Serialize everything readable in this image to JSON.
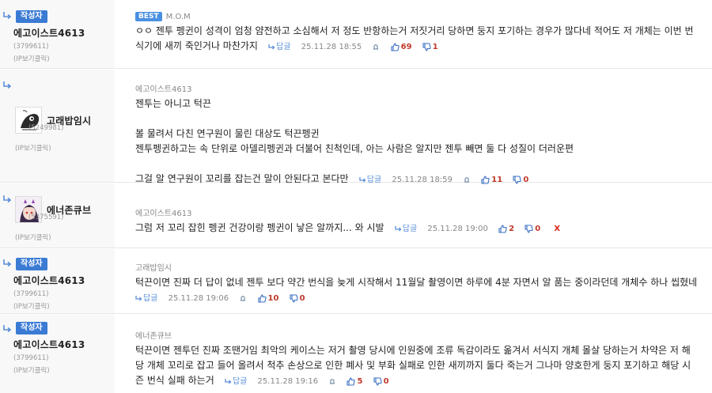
{
  "comments": [
    {
      "writer_badge": "작성자",
      "nick": "에고이스트4613",
      "uid": "(3799611)",
      "ip": "(IP보기클릭)",
      "best": "BEST",
      "ref": "M.O.M",
      "lines": [
        "ㅇㅇ 젠투 펭귄이 성격이 엄청 얌전하고 소심해서 저 정도 반항하는거 저짓거리 당하면 둥지 포기하는 경우가 많다네 적어도 저 개체는 이번 번",
        "식기에 새끼 죽인거나 마찬가지"
      ],
      "reply": "답글",
      "date": "25.11.28 18:55",
      "up": "69",
      "down": "1"
    },
    {
      "nick": "고래밥임시",
      "uid": "(5249981)",
      "ip": "(IP보기클릭)",
      "ref": "에고이스트4613",
      "lines": [
        "젠투는 아니고 턱끈",
        "",
        "볼 물려서 다친 연구원이 물린 대상도 턱끈펭귄",
        "젠투펭귄하고는 속 단위로 아델리펭귄과 더불어 친척인데, 아는 사람은 알지만 젠투 빼면 둘 다 성질이 더러운편",
        "",
        "그걸 알 연구원이 꼬리를 잡는건 말이 안된다고 본다만"
      ],
      "reply": "답글",
      "date": "25.11.28 18:59",
      "up": "11",
      "down": "0"
    },
    {
      "nick": "에너존큐브",
      "uid": "(5375591)",
      "ip": "(IP보기클릭)",
      "ref": "에고이스트4613",
      "lines": [
        "그럼 저 꼬리 잡힌 펭귄 건강이랑 펭귄이 낳은 알까지... 와 시발"
      ],
      "reply": "답글",
      "date": "25.11.28 19:00",
      "up": "2",
      "down": "0",
      "delete": "X"
    },
    {
      "writer_badge": "작성자",
      "nick": "에고이스트4613",
      "uid": "(3799611)",
      "ip": "(IP보기클릭)",
      "ref": "고래밥임시",
      "lines": [
        "턱끈이면 진짜 더 답이 없네 젠투 보다 약간 번식을 늦게 시작해서 11월달 촬영이면 하루에 4분 자면서 알 품는 중이라던데 개체수 하나 씹혔네"
      ],
      "reply": "답글",
      "date": "25.11.28 19:06",
      "up": "10",
      "down": "0"
    },
    {
      "writer_badge": "작성자",
      "nick": "에고이스트4613",
      "uid": "(3799611)",
      "ip": "(IP보기클릭)",
      "ref": "에너존큐브",
      "lines": [
        "턱끈이면 젠투던 진짜 조땐거임 최악의 케이스는 저거 촬영 당시에 인원중에 조류 독감이라도 옮겨서 서식지 개체 몰살 당하는거 차약은 저 해",
        "당 개체 꼬리로 잡고 들어 올려서 척추 손상으로 인한 폐사 및 부화 실패로 인한 새끼까지 둘다 죽는거 그나마 양호한게 둥지 포기하고 해당 시",
        "즌 번식 실패 하는거"
      ],
      "reply": "답글",
      "date": "25.11.28 19:16",
      "up": "5",
      "down": "0"
    }
  ]
}
